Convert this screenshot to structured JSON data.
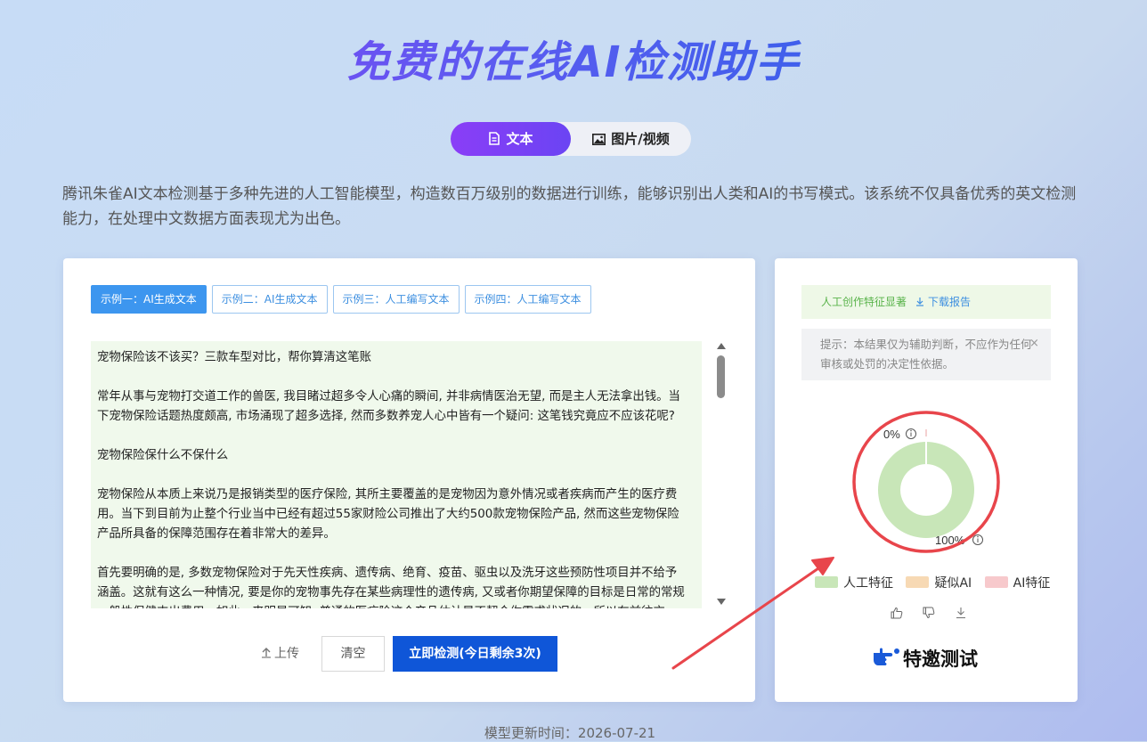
{
  "header": {
    "title": "免费的在线AI检测助手",
    "tabs": [
      {
        "label": "文本",
        "icon": "document-icon",
        "active": true
      },
      {
        "label": "图片/视频",
        "icon": "image-icon",
        "active": false
      }
    ],
    "description": "腾讯朱雀AI文本检测基于多种先进的人工智能模型，构造数百万级别的数据进行训练，能够识别出人类和AI的书写模式。该系统不仅具备优秀的英文检测能力，在处理中文数据方面表现尤为出色。"
  },
  "editor": {
    "examples": [
      {
        "label": "示例一：AI生成文本",
        "active": true
      },
      {
        "label": "示例二：AI生成文本",
        "active": false
      },
      {
        "label": "示例三：人工编写文本",
        "active": false
      },
      {
        "label": "示例四：人工编写文本",
        "active": false
      }
    ],
    "paragraphs": [
      "宠物保险该不该买？三款车型对比，帮你算清这笔账",
      "常年从事与宠物打交道工作的兽医, 我目睹过超多令人心痛的瞬间, 并非病情医治无望, 而是主人无法拿出钱。当下宠物保险话题热度颇高, 市场涌现了超多选择, 然而多数养宠人心中皆有一个疑问: 这笔钱究竟应不应该花呢?",
      "宠物保险保什么不保什么",
      "宠物保险从本质上来说乃是报销类型的医疗保险, 其所主要覆盖的是宠物因为意外情况或者疾病而产生的医疗费用。当下到目前为止整个行业当中已经有超过55家财险公司推出了大约500款宠物保险产品, 然而这些宠物保险产品所具备的保障范围存在着非常大的差异。",
      "首先要明确的是, 多数宠物保险对于先天性疾病、遗传病、绝育、疫苗、驱虫以及洗牙这些预防性项目并不给予涵盖。这就有这么一种情况, 要是你的宠物事先存在某些病理性的遗传病, 又或者你期望保障的目标是日常的常规一般性保健支出费用。如此一来明显可知, 普通的医疗险这个产品估计是不契合你需求状况的。所以在前往交"
    ],
    "upload_label": "上传",
    "clear_label": "清空",
    "detect_label": "立即检测(今日剩余3次)"
  },
  "result": {
    "label": "人工创作特征显著",
    "download_label": "下载报告",
    "tip": "提示：本结果仅为辅助判断，不应作为任何审核或处罚的决定性依据。",
    "close_symbol": "×",
    "ai_percent_label": "0%",
    "human_percent_label": "100%",
    "legend": [
      {
        "label": "人工特征",
        "color": "#c8e6b8"
      },
      {
        "label": "疑似AI",
        "color": "#f7d9b4"
      },
      {
        "label": "AI特征",
        "color": "#f7c9cc"
      }
    ],
    "invite_label": "特邀测试"
  },
  "chart_data": {
    "type": "pie",
    "categories": [
      "人工特征",
      "疑似AI",
      "AI特征"
    ],
    "values": [
      100,
      0,
      0
    ],
    "colors": [
      "#c8e6b8",
      "#f7d9b4",
      "#f7c9cc"
    ]
  },
  "footer": {
    "model_time": "模型更新时间：2026-07-21"
  },
  "colors": {
    "accent_purple": "#7a40f5",
    "primary_blue": "#0f56d8",
    "annotation_red": "#e8454b"
  }
}
